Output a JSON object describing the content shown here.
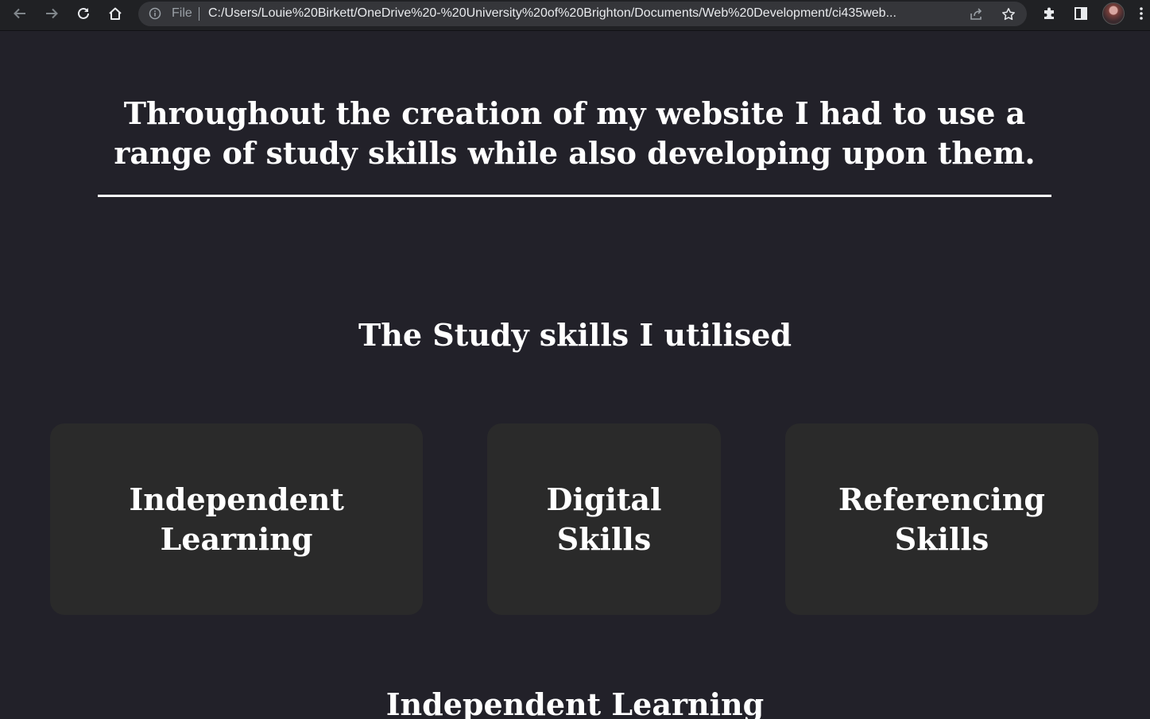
{
  "browser": {
    "scheme_label": "File",
    "url": "C:/Users/Louie%20Birkett/OneDrive%20-%20University%20of%20Brighton/Documents/Web%20Development/ci435web...",
    "icons": [
      "back-arrow-icon",
      "forward-arrow-icon",
      "reload-icon",
      "home-icon",
      "info-icon",
      "share-icon",
      "star-icon",
      "extensions-icon",
      "side-panel-icon",
      "profile-avatar",
      "menu-icon"
    ]
  },
  "page": {
    "intro": "Throughout the creation of my website I had to use a range of study skills while also developing upon them.",
    "section_heading": "The Study skills I utilised",
    "cards": [
      {
        "label": "Independent Learning"
      },
      {
        "label": "Digital Skills"
      },
      {
        "label": "Referencing Skills"
      }
    ],
    "subheading": "Independent Learning"
  },
  "colors": {
    "background": "#222129",
    "card": "#2a2a2a",
    "text": "#ffffff",
    "toolbar": "#202124",
    "omnibox": "#35363a"
  }
}
